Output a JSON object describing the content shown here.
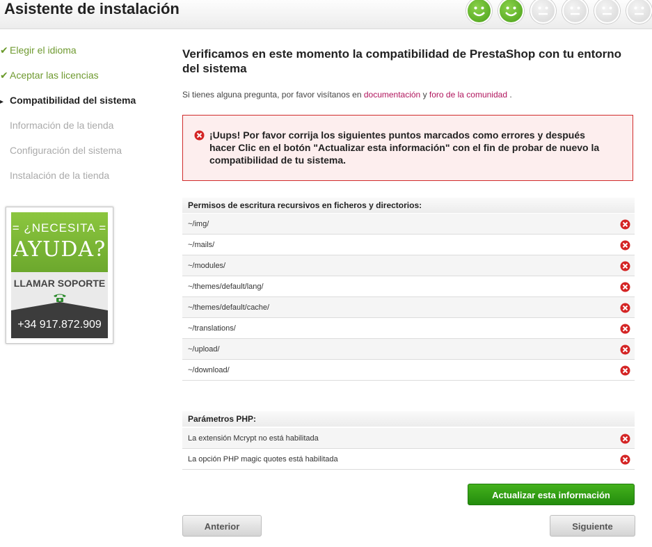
{
  "header": {
    "title": "Asistente de instalación",
    "progress": [
      "happy",
      "happy",
      "neutral",
      "neutral",
      "neutral",
      "neutral"
    ]
  },
  "sidebar": {
    "steps": [
      {
        "label": "Elegir el idioma",
        "state": "done"
      },
      {
        "label": "Aceptar las licencias",
        "state": "done"
      },
      {
        "label": "Compatibilidad del sistema",
        "state": "current"
      },
      {
        "label": "Información de la tienda",
        "state": "todo"
      },
      {
        "label": "Configuración del sistema",
        "state": "todo"
      },
      {
        "label": "Instalación de la tienda",
        "state": "todo"
      }
    ],
    "help": {
      "need": "= ¿NECESITA =",
      "ayuda": "AYUDA?",
      "call": "LLAMAR SOPORTE",
      "phone": "+34 917.872.909"
    }
  },
  "main": {
    "title": "Verificamos en este momento la compatibilidad de PrestaShop con tu entorno del sistema",
    "intro_before": "Si tienes alguna pregunta, por favor visítanos en",
    "link_docs": "documentación",
    "intro_and": "y",
    "link_forum": "foro de la comunidad",
    "intro_after": ".",
    "error": "¡Uups! Por favor corrija los siguientes puntos marcados como errores y después hacer Clic en el botón \"Actualizar esta información\" con el fin de probar de nuevo la compatibilidad de tu sistema.",
    "permissions": {
      "heading": "Permisos de escritura recursivos en ficheros y directorios:",
      "items": [
        "~/img/",
        "~/mails/",
        "~/modules/",
        "~/themes/default/lang/",
        "~/themes/default/cache/",
        "~/translations/",
        "~/upload/",
        "~/download/"
      ]
    },
    "php": {
      "heading": "Parámetros PHP:",
      "items": [
        "La extensión Mcrypt no está habilitada",
        "La opción PHP magic quotes está habilitada"
      ]
    },
    "buttons": {
      "update": "Actualizar esta información",
      "previous": "Anterior",
      "next": "Siguiente"
    }
  },
  "colors": {
    "accent_green": "#2e9a14",
    "link": "#b0145c",
    "error_border": "#d02b2b",
    "done_step": "#6f9a30"
  }
}
